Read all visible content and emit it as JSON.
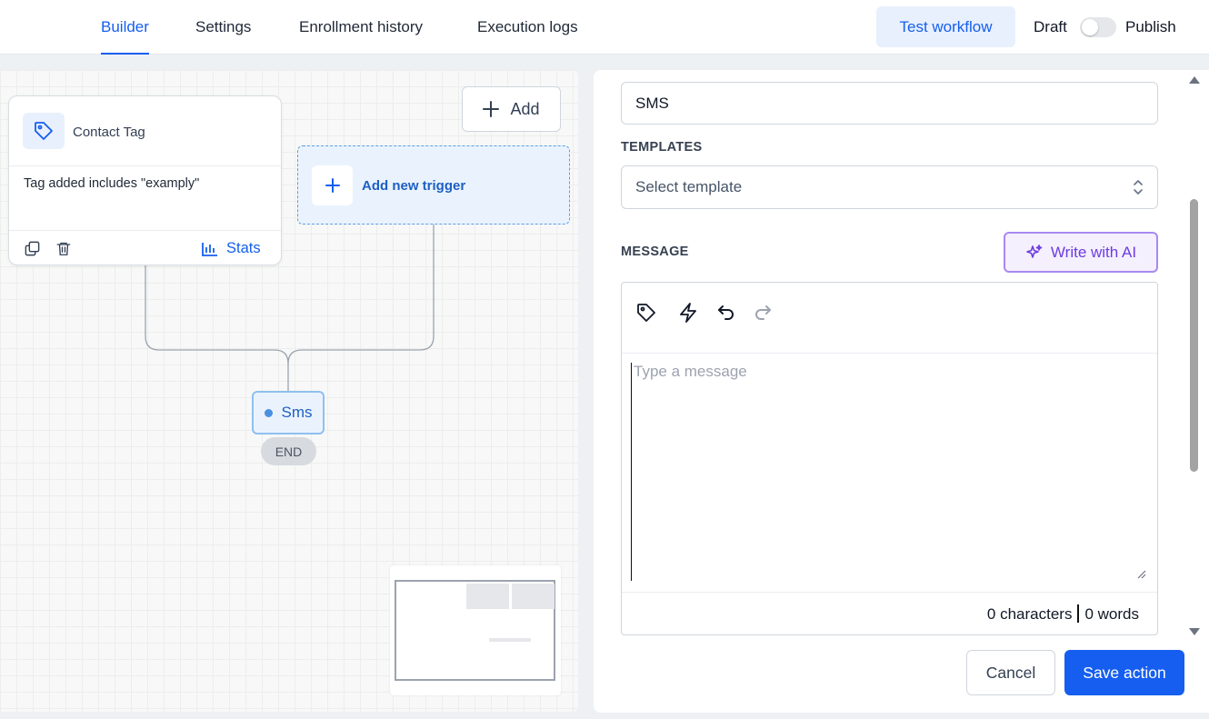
{
  "tabs": [
    {
      "label": "Builder",
      "active": true
    },
    {
      "label": "Settings",
      "active": false
    },
    {
      "label": "Enrollment history",
      "active": false
    },
    {
      "label": "Execution logs",
      "active": false
    }
  ],
  "header": {
    "test_workflow_label": "Test workflow",
    "draft_label": "Draft",
    "publish_label": "Publish",
    "published": false
  },
  "canvas": {
    "trigger_card": {
      "title": "Contact Tag",
      "description": "Tag added includes \"examply\"",
      "stats_label": "Stats"
    },
    "add_label": "Add",
    "add_trigger_label": "Add new trigger",
    "action_node_label": "Sms",
    "end_label": "END"
  },
  "panel": {
    "action_name_value": "SMS",
    "templates_label": "TEMPLATES",
    "template_placeholder": "Select template",
    "message_label": "MESSAGE",
    "write_ai_label": "Write with AI",
    "message_placeholder": "Type a message",
    "message_value": "",
    "characters_text": "0 characters",
    "words_text": "0 words",
    "cancel_label": "Cancel",
    "save_label": "Save action"
  },
  "colors": {
    "primary": "#155eef",
    "ai_accent": "#6d3ce0",
    "trigger_fill": "#eaf3fd"
  }
}
